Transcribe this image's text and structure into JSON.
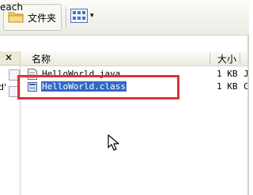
{
  "toolbar": {
    "folders_label": "文件夹",
    "views_arrow": "▾"
  },
  "addressbar": {
    "text": "each"
  },
  "left_panel": {
    "close_glyph": "✕",
    "partial_text": "d'"
  },
  "list": {
    "columns": {
      "name": "名称",
      "size": "大小"
    },
    "rows": [
      {
        "name": "HelloWorld.java",
        "size": "1 KB",
        "type": "J",
        "icon": "java-file-icon",
        "selected": false
      },
      {
        "name": "HelloWorld.class",
        "size": "1 KB",
        "type": "C",
        "icon": "class-file-icon",
        "selected": true
      }
    ]
  },
  "colors": {
    "selection": "#316ac5",
    "highlight_box": "#e0313a"
  }
}
